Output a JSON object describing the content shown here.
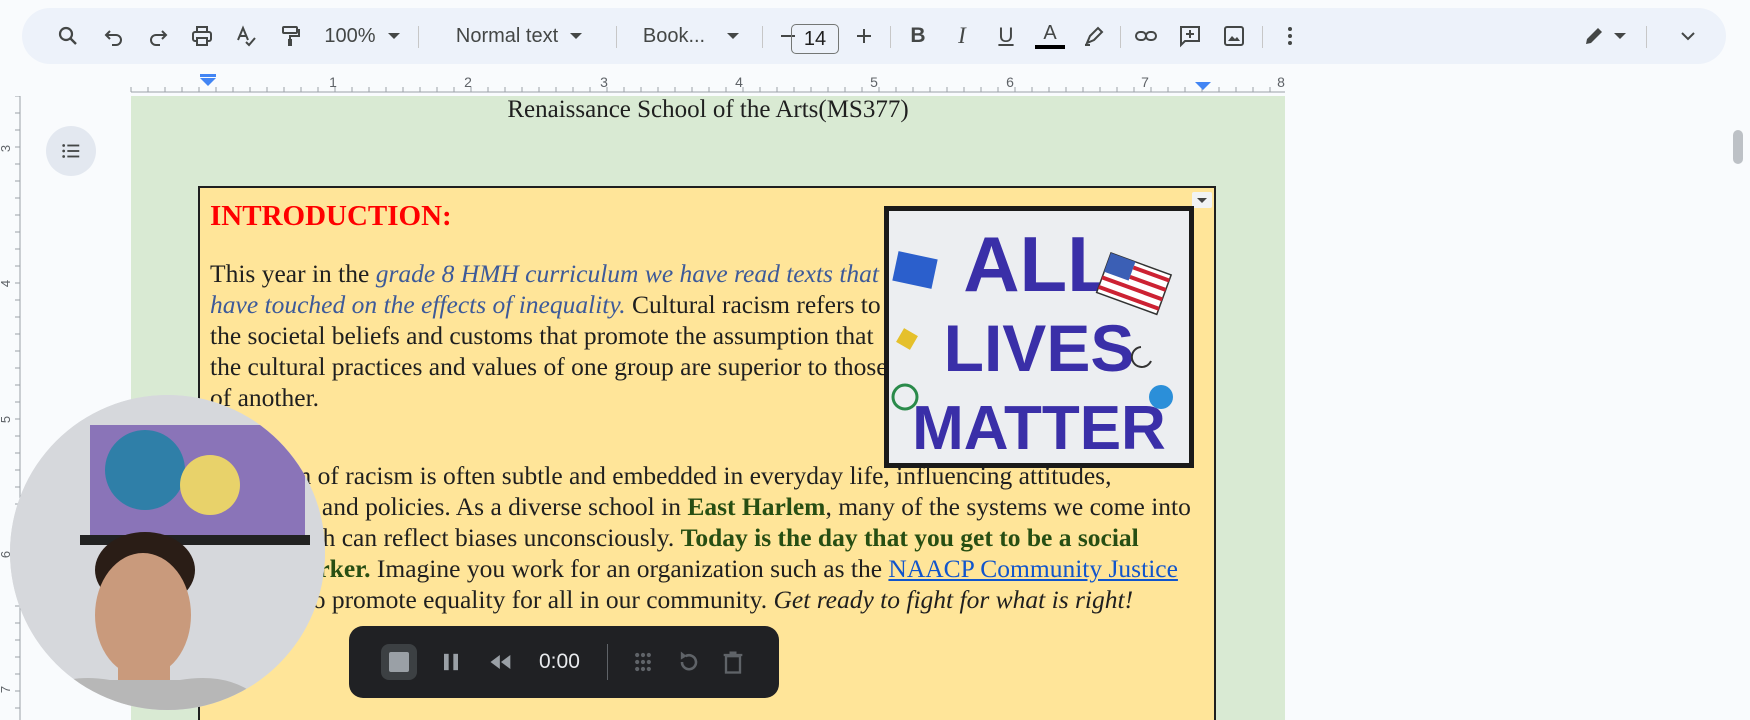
{
  "toolbar": {
    "zoom": "100%",
    "style": "Normal text",
    "font": "Book...",
    "font_size": "14",
    "bold_label": "B",
    "italic_label": "I",
    "underline_label": "U",
    "text_color_label": "A",
    "icons": [
      "search-icon",
      "undo-icon",
      "redo-icon",
      "print-icon",
      "spellcheck-icon",
      "paint-format-icon",
      "decrease-font-icon",
      "increase-font-icon",
      "highlight-icon",
      "link-icon",
      "add-comment-icon",
      "insert-image-icon",
      "more-icon",
      "edit-mode-icon",
      "collapse-icon"
    ]
  },
  "ruler": {
    "h_numbers": [
      "1",
      "2",
      "3",
      "4",
      "5",
      "6",
      "7",
      "8"
    ],
    "v_numbers": [
      "3",
      "4",
      "5",
      "6",
      "7"
    ]
  },
  "document": {
    "school": "Renaissance School of the Arts(MS377)",
    "intro_heading": "INTRODUCTION:",
    "p1_a": "This year in the ",
    "p1_b": "grade 8 HMH curriculum we have read texts that have touched on the effects of inequality.",
    "p1_c": " Cultural racism refers to the societal beliefs and customs that promote the assumption that the cultural practices and values of one group are superior to those of another.",
    "p2_a": "This form of racism is often subtle and embedded in everyday life, influencing attitudes, behaviors, and policies. As a diverse school in ",
    "p2_b": "East Harlem",
    "p2_c": ", many of the systems we come into contact with can reflect biases unconsciously. ",
    "p2_d": "Today is the day that you get to be a social justice worker.",
    "p2_e": " Imagine you work for an organization such as the ",
    "p2_link": "NAACP Community Justice Network",
    "p2_f": " to promote equality for all in our community. ",
    "p2_g": "Get ready to fight for what is right!",
    "image_text": [
      "ALL",
      "LIVES",
      "MATTER"
    ]
  },
  "recorder": {
    "time": "0:00"
  },
  "colors": {
    "page_bg": "#d9ead3",
    "box_bg": "#ffe599",
    "heading_red": "#ff0000",
    "italic_blue": "#3d5a99",
    "bold_green": "#274e13"
  }
}
